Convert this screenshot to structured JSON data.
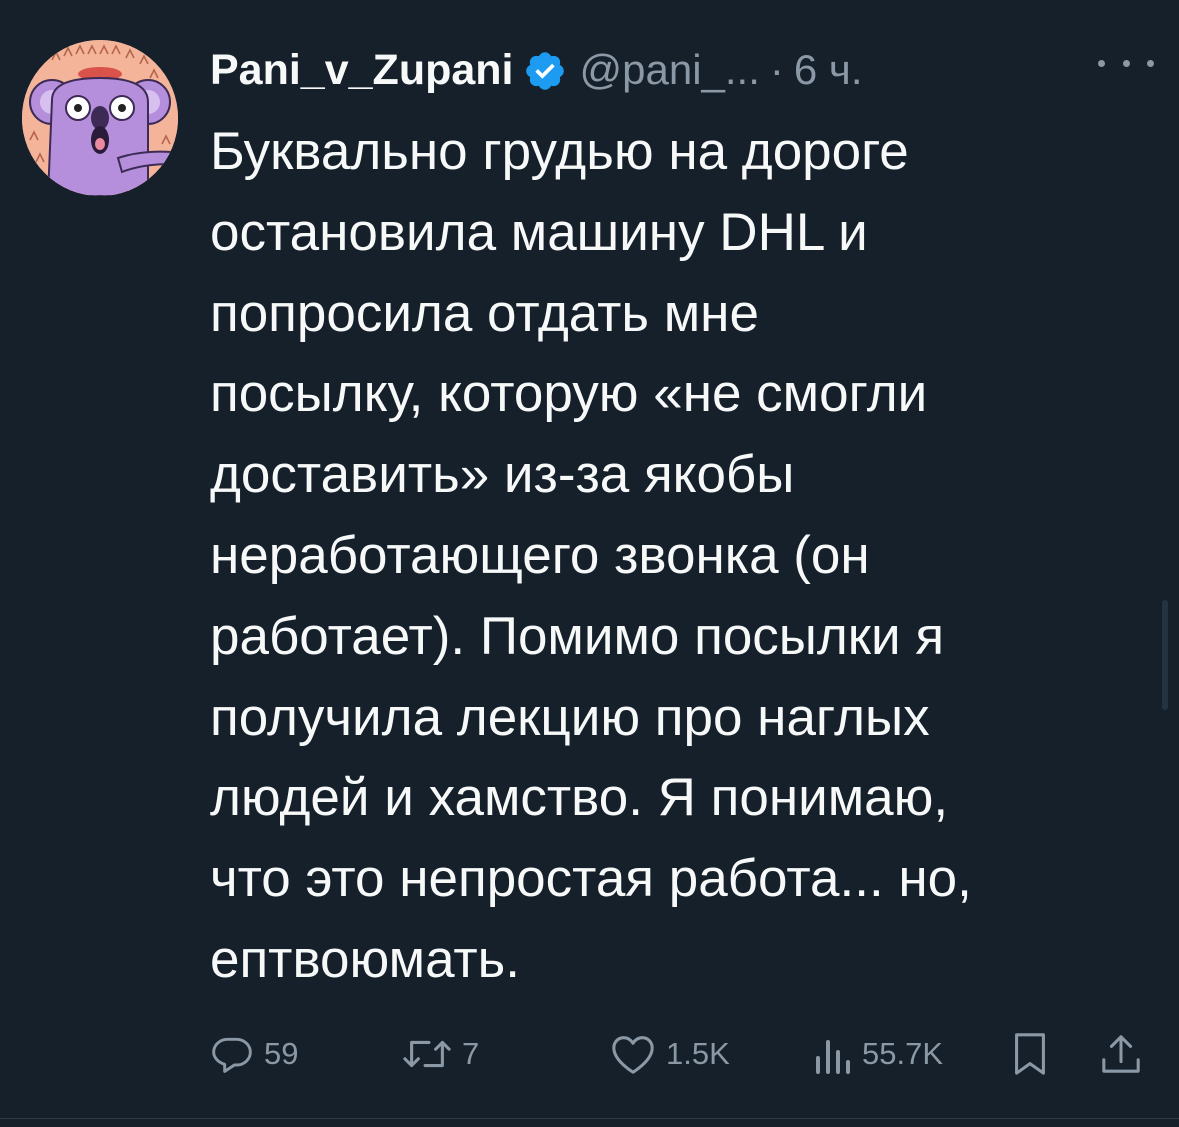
{
  "author": {
    "display_name": "Pani_v_Zupani",
    "handle": "@pani_...",
    "separator": "·",
    "time": "6 ч.",
    "verified_icon": "verified-badge-icon",
    "avatar": "koala-avatar"
  },
  "tweet": {
    "lines": [
      "Буквально грудью на дороге",
      "остановила машину DHL и",
      "попросила отдать мне",
      "посылку, которую «не смогли",
      "доставить» из-за якобы",
      "неработающего звонка (он",
      "работает). Помимо посылки я",
      "получила лекцию про наглых",
      "людей и хамство. Я понимаю,",
      "что это непростая работа... но,",
      "ептвоюмать."
    ]
  },
  "actions": {
    "reply_count": "59",
    "retweet_count": "7",
    "like_count": "1.5K",
    "views_count": "55.7K"
  },
  "colors": {
    "background": "#15202b",
    "text": "#f7f9f9",
    "secondary": "#8b98a5",
    "verified": "#1d9bf0"
  }
}
